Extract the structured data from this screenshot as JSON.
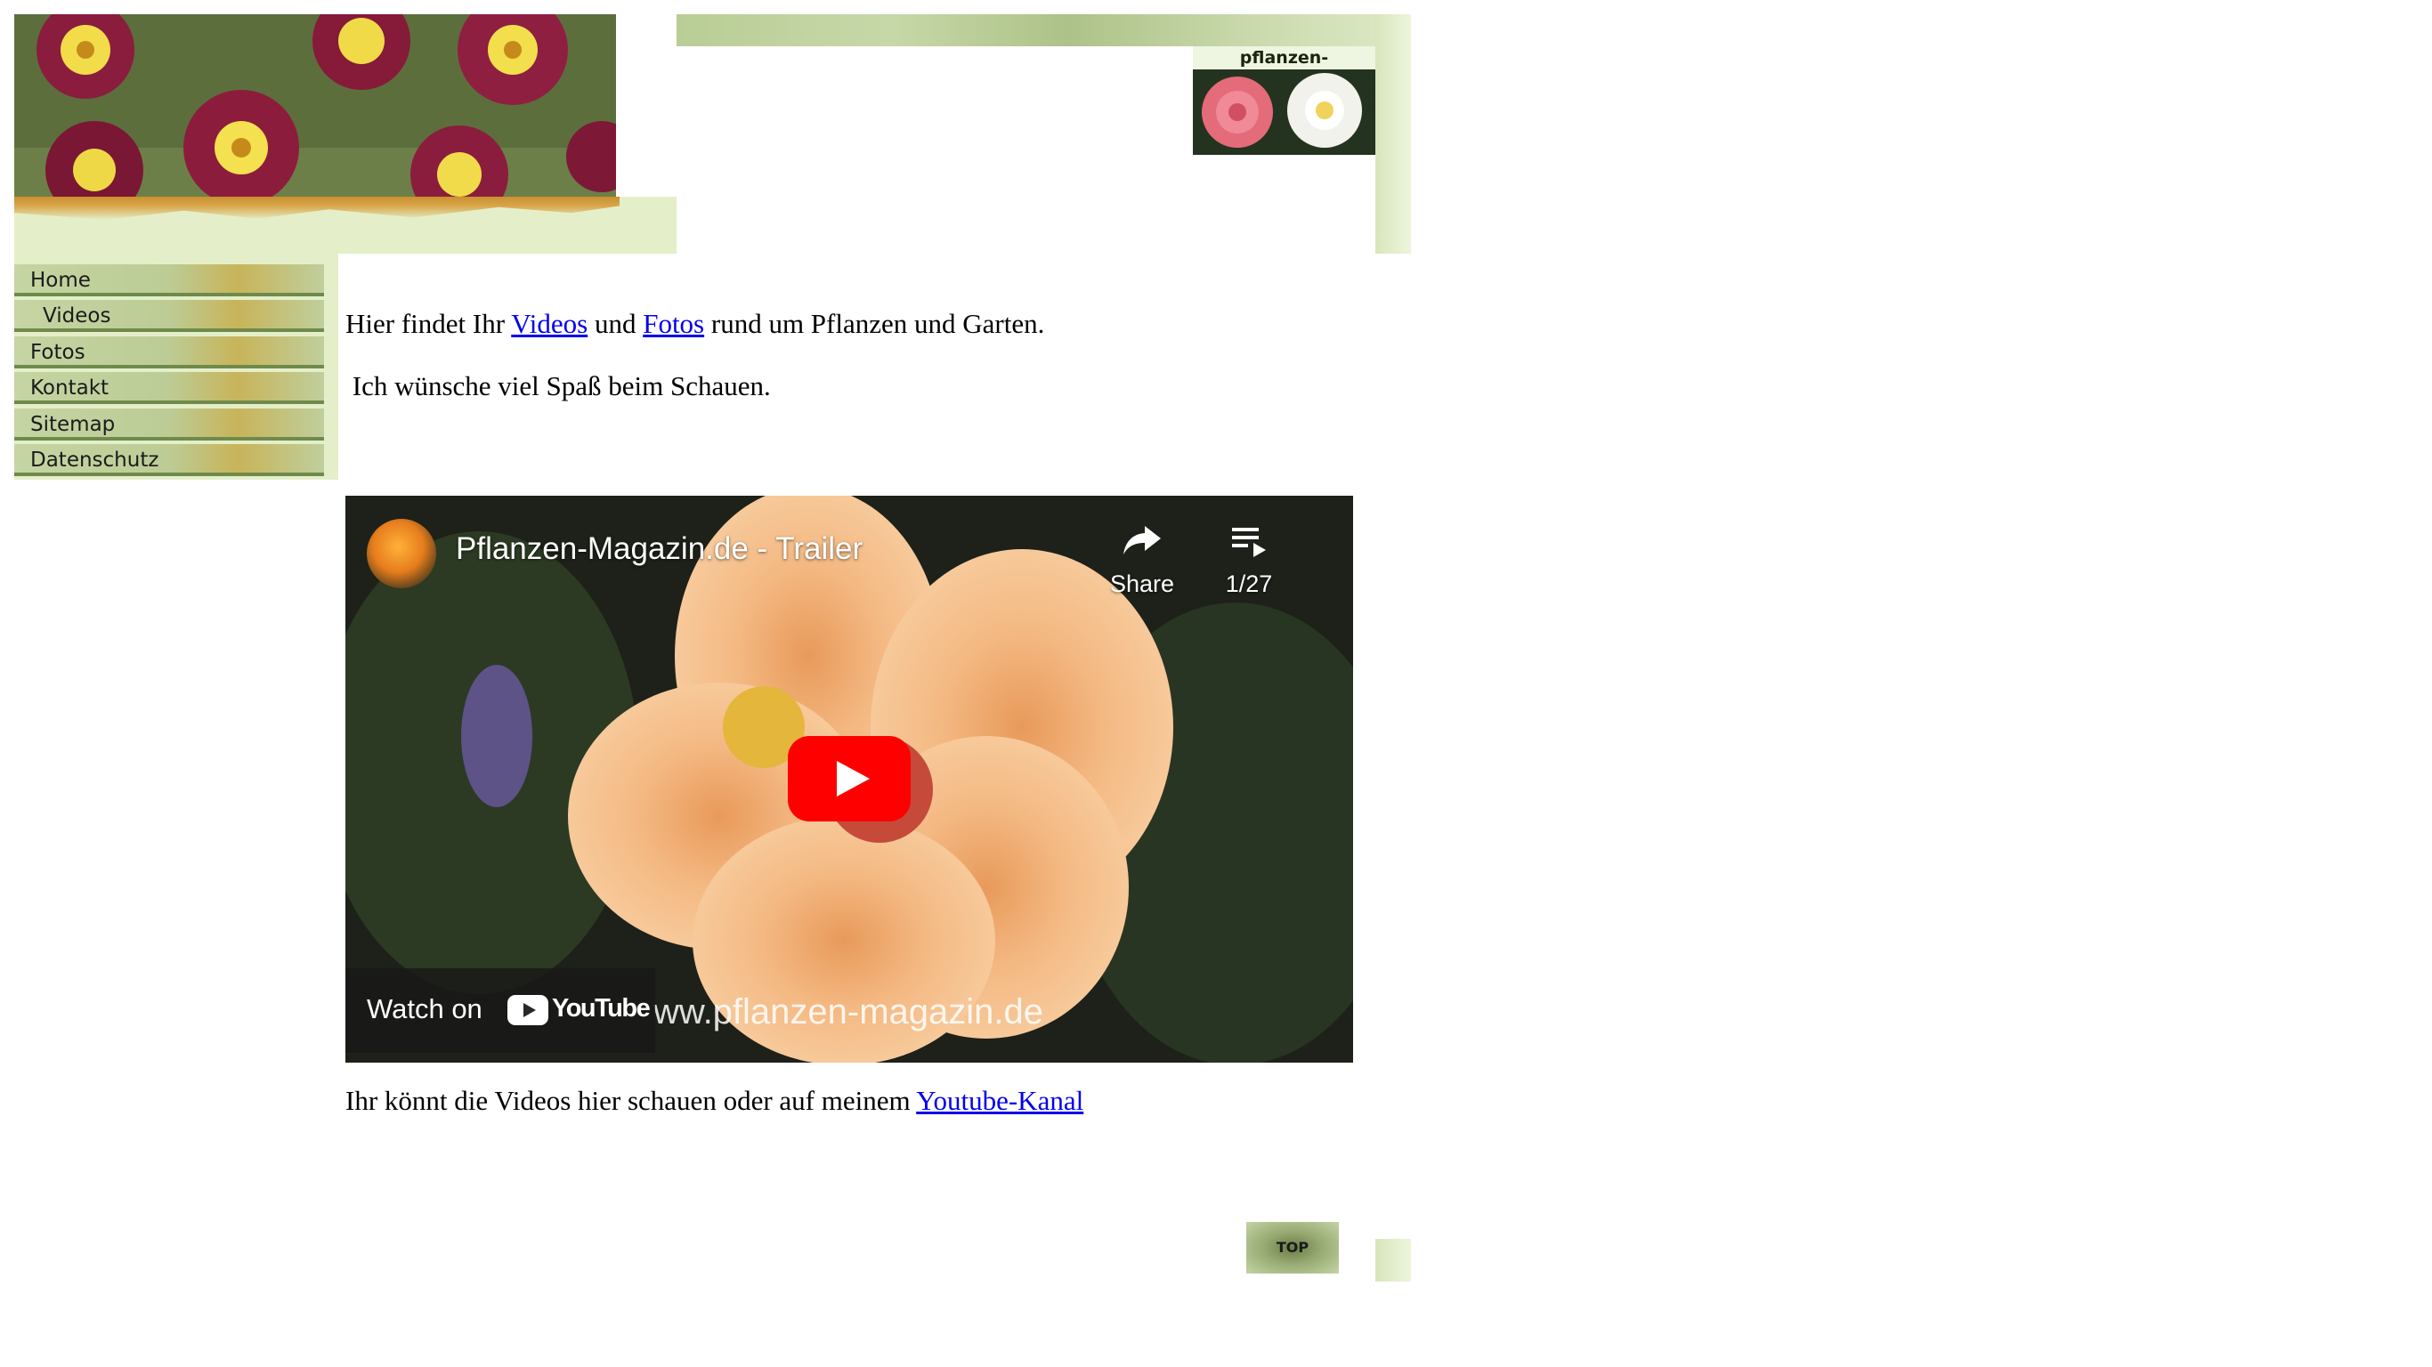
{
  "header": {
    "logo_text": "pflanzen-magazin.de"
  },
  "nav": {
    "items": [
      {
        "label": "Home"
      },
      {
        "label": "Videos"
      },
      {
        "label": "Fotos"
      },
      {
        "label": "Kontakt"
      },
      {
        "label": "Sitemap"
      },
      {
        "label": "Datenschutz"
      }
    ]
  },
  "content": {
    "intro_before": "Hier findet Ihr ",
    "intro_link_videos": "Videos",
    "intro_and": " und ",
    "intro_link_fotos": "Fotos",
    "intro_after": " rund um Pflanzen und Garten.",
    "greeting": " Ich wünsche viel Spaß beim Schauen.",
    "outro_before": "Ihr könnt die Videos hier schauen oder auf meinem ",
    "outro_link": "Youtube-Kanal"
  },
  "video": {
    "title": "Pflanzen-Magazin.de - Trailer",
    "share_label": "Share",
    "playlist_position": "1/27",
    "watch_on": "Watch on",
    "youtube_label": "YouTube",
    "watermark": "ww.pflanzen-magazin.de",
    "play_color": "#ff0000"
  },
  "footer": {
    "top_label": "TOP"
  },
  "colors": {
    "link": "#0000ee",
    "nav_bg": "#e4efc9",
    "band": "#c7d8a8"
  }
}
